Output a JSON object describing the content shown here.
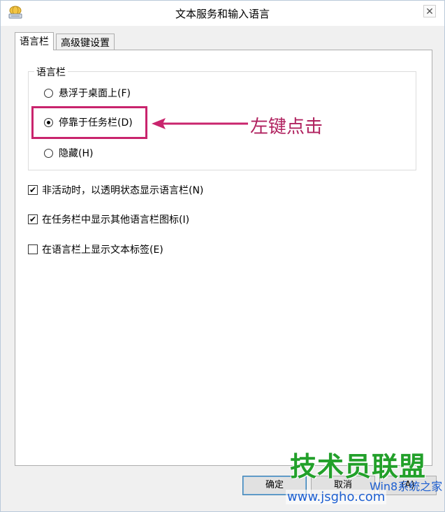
{
  "window": {
    "title": "文本服务和输入语言",
    "close_glyph": "✕",
    "app_icon": "keyboard-globe-icon"
  },
  "tabs": [
    {
      "label": "语言栏",
      "active": true
    },
    {
      "label": "高级键设置",
      "active": false
    }
  ],
  "language_bar_group": {
    "legend": "语言栏",
    "options": [
      {
        "label": "悬浮于桌面上(F)",
        "checked": false
      },
      {
        "label": "停靠于任务栏(D)",
        "checked": true
      },
      {
        "label": "隐藏(H)",
        "checked": false
      }
    ]
  },
  "checkboxes": [
    {
      "label": "非活动时，以透明状态显示语言栏(N)",
      "checked": true
    },
    {
      "label": "在任务栏中显示其他语言栏图标(I)",
      "checked": true
    },
    {
      "label": "在语言栏上显示文本标签(E)",
      "checked": false
    }
  ],
  "annotation": {
    "text": "左键点击",
    "color": "#c9246d"
  },
  "buttons": {
    "ok": "确定",
    "cancel": "取消",
    "apply": "(A)"
  },
  "watermark": {
    "main": "技术员联盟",
    "url": "www.jsgho.com",
    "sub": "Win8系统之家"
  }
}
